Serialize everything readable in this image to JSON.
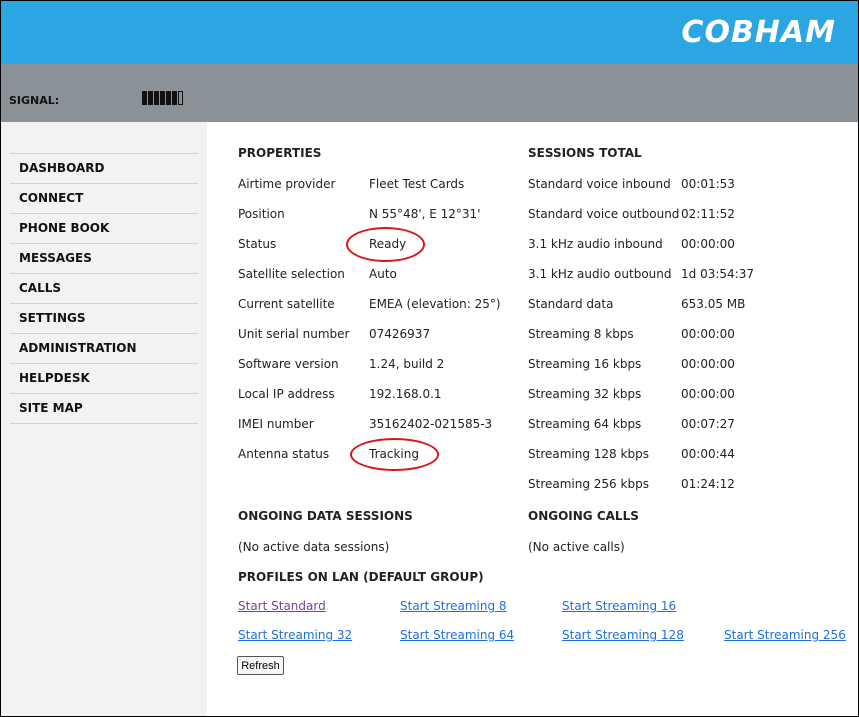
{
  "header": {
    "logo": "COBHAM"
  },
  "status_bar": {
    "signal_label": "SIGNAL:",
    "signal_level_bars_filled": 6,
    "signal_level_bars_total": 7
  },
  "sidebar": {
    "items": [
      {
        "label": "DASHBOARD"
      },
      {
        "label": "CONNECT"
      },
      {
        "label": "PHONE BOOK"
      },
      {
        "label": "MESSAGES"
      },
      {
        "label": "CALLS"
      },
      {
        "label": "SETTINGS"
      },
      {
        "label": "ADMINISTRATION"
      },
      {
        "label": "HELPDESK"
      },
      {
        "label": "SITE MAP"
      }
    ]
  },
  "properties": {
    "title": "PROPERTIES",
    "rows": [
      {
        "label": "Airtime provider",
        "value": "Fleet Test Cards"
      },
      {
        "label": "Position",
        "value": "N 55°48', E 12°31'"
      },
      {
        "label": "Status",
        "value": "Ready"
      },
      {
        "label": "Satellite selection",
        "value": "Auto"
      },
      {
        "label": "Current satellite",
        "value": "EMEA (elevation: 25°)"
      },
      {
        "label": "Unit serial number",
        "value": "07426937"
      },
      {
        "label": "Software version",
        "value": "1.24, build 2"
      },
      {
        "label": "Local IP address",
        "value": "192.168.0.1"
      },
      {
        "label": "IMEI number",
        "value": "35162402-021585-3"
      },
      {
        "label": "Antenna status",
        "value": "Tracking"
      }
    ]
  },
  "sessions_total": {
    "title": "SESSIONS TOTAL",
    "rows": [
      {
        "label": "Standard voice inbound",
        "value": "00:01:53"
      },
      {
        "label": "Standard voice outbound",
        "value": "02:11:52"
      },
      {
        "label": "3.1 kHz audio inbound",
        "value": "00:00:00"
      },
      {
        "label": "3.1 kHz audio outbound",
        "value": "1d 03:54:37"
      },
      {
        "label": "Standard data",
        "value": "653.05 MB"
      },
      {
        "label": "Streaming 8 kbps",
        "value": "00:00:00"
      },
      {
        "label": "Streaming 16 kbps",
        "value": "00:00:00"
      },
      {
        "label": "Streaming 32 kbps",
        "value": "00:00:00"
      },
      {
        "label": "Streaming 64 kbps",
        "value": "00:07:27"
      },
      {
        "label": "Streaming 128 kbps",
        "value": "00:00:44"
      },
      {
        "label": "Streaming 256 kbps",
        "value": "01:24:12"
      }
    ]
  },
  "ongoing_data_sessions": {
    "title": "ONGOING DATA SESSIONS",
    "text": "(No active data sessions)"
  },
  "ongoing_calls": {
    "title": "ONGOING CALLS",
    "text": "(No active calls)"
  },
  "profiles": {
    "title": "PROFILES ON LAN (DEFAULT GROUP)",
    "links": [
      {
        "label": "Start Standard"
      },
      {
        "label": "Start Streaming 8"
      },
      {
        "label": "Start Streaming 16"
      },
      {
        "label": "Start Streaming 32"
      },
      {
        "label": "Start Streaming 64"
      },
      {
        "label": "Start Streaming 128"
      },
      {
        "label": "Start Streaming 256"
      }
    ],
    "refresh_label": "Refresh"
  },
  "colors": {
    "header_blue": "#2ba6e3",
    "signal_gray": "#8b9297",
    "link_blue": "#1e6fd9",
    "visited_link": "#7c3f96",
    "highlight_red": "#d9141a"
  }
}
